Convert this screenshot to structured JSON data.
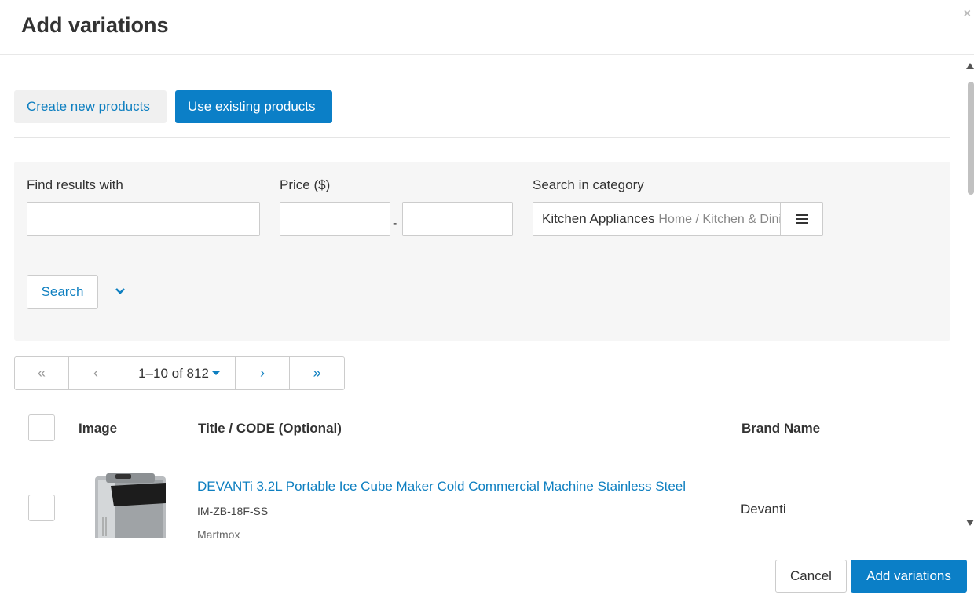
{
  "dialog": {
    "title": "Add variations",
    "close_icon": "×"
  },
  "tabs": {
    "create_new": "Create new products",
    "use_existing": "Use existing products"
  },
  "filters": {
    "find_label": "Find results with",
    "find_value": "",
    "price_label": "Price ($)",
    "price_min": "",
    "price_max": "",
    "price_separator": "-",
    "category_label": "Search in category",
    "category_name": "Kitchen Appliances",
    "category_path": "Home / Kitchen & Dining",
    "search_button": "Search"
  },
  "pager": {
    "first": "«",
    "prev": "‹",
    "range": "1–10 of 812",
    "next": "›",
    "last": "»"
  },
  "table": {
    "headers": {
      "image": "Image",
      "title": "Title / CODE (Optional)",
      "brand": "Brand Name"
    },
    "rows": [
      {
        "title": "DEVANTi 3.2L Portable Ice Cube Maker Cold Commercial Machine Stainless Steel",
        "code": "IM-ZB-18F-SS",
        "seller": "Martmox",
        "brand": "Devanti"
      }
    ]
  },
  "footer": {
    "cancel": "Cancel",
    "add": "Add variations"
  },
  "colors": {
    "accent": "#0b7fc7",
    "link": "#0e7fc0",
    "panel_bg": "#f6f6f6"
  }
}
